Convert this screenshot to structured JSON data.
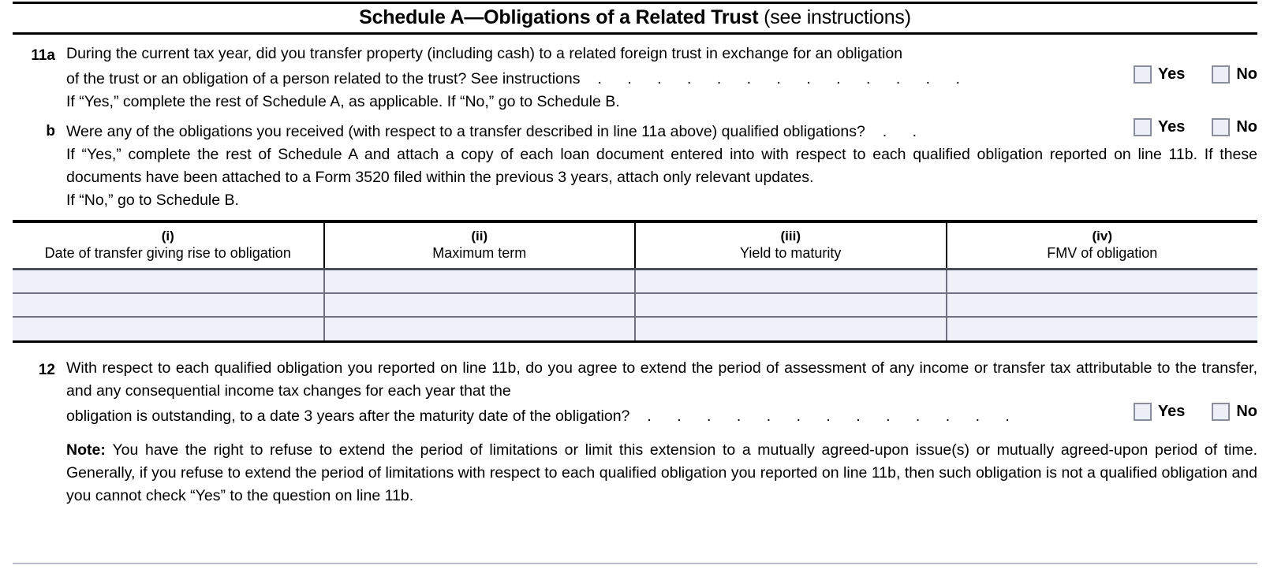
{
  "schedule": {
    "title_bold": "Schedule A—Obligations of a Related Trust",
    "title_note": "(see instructions)"
  },
  "line_11a": {
    "number": "11a",
    "text_line1": "During the current tax year, did you transfer property (including cash) to a related foreign trust in exchange for an obligation",
    "text_line2": "of the trust or an obligation of a person related to the trust? See instructions",
    "leaders": ". . . . . . . . . . . . .",
    "yes_label": "Yes",
    "no_label": "No",
    "followup": "If “Yes,” complete the rest of Schedule A, as applicable. If “No,” go to Schedule B."
  },
  "line_11b": {
    "number": "b",
    "question": "Were any of the obligations you received (with respect to a transfer described in line 11a above) qualified obligations?",
    "leaders": ". .",
    "yes_label": "Yes",
    "no_label": "No",
    "followup_yes": "If “Yes,” complete the rest of Schedule A and attach a copy of each loan document entered into with respect to each qualified obligation reported on line 11b. If these documents have been attached to a Form 3520 filed within the previous 3 years, attach only relevant updates.",
    "followup_no": "If “No,” go to Schedule B."
  },
  "table": {
    "columns": [
      {
        "numeral": "(i)",
        "description": "Date of transfer giving rise to obligation"
      },
      {
        "numeral": "(ii)",
        "description": "Maximum term"
      },
      {
        "numeral": "(iii)",
        "description": "Yield to maturity"
      },
      {
        "numeral": "(iv)",
        "description": "FMV of obligation"
      }
    ],
    "rows": [
      [
        "",
        "",
        "",
        ""
      ],
      [
        "",
        "",
        "",
        ""
      ],
      [
        "",
        "",
        "",
        ""
      ]
    ]
  },
  "line_12": {
    "number": "12",
    "text_block": "With respect to each qualified obligation you reported on line 11b, do you agree to extend the period of assessment of any income or transfer tax attributable to the transfer, and any consequential income tax changes for each year that the",
    "text_last": "obligation is outstanding, to a date 3 years after the maturity date of the obligation?",
    "leaders": ". . . . . . . . . . . . .",
    "yes_label": "Yes",
    "no_label": "No",
    "note_label": "Note:",
    "note_text": "You have the right to refuse to extend the period of limitations or limit this extension to a mutually agreed-upon issue(s) or mutually agreed-upon period of time. Generally, if you refuse to extend the period of limitations with respect to each qualified obligation you reported on line 11b, then such obligation is not a qualified obligation and you cannot check “Yes” to the question on line 11b."
  },
  "colors": {
    "checkbox_fill": "#eceef8",
    "checkbox_border": "#8a8d9c",
    "table_row_fill": "#eff1fa",
    "rule": "#000000"
  }
}
